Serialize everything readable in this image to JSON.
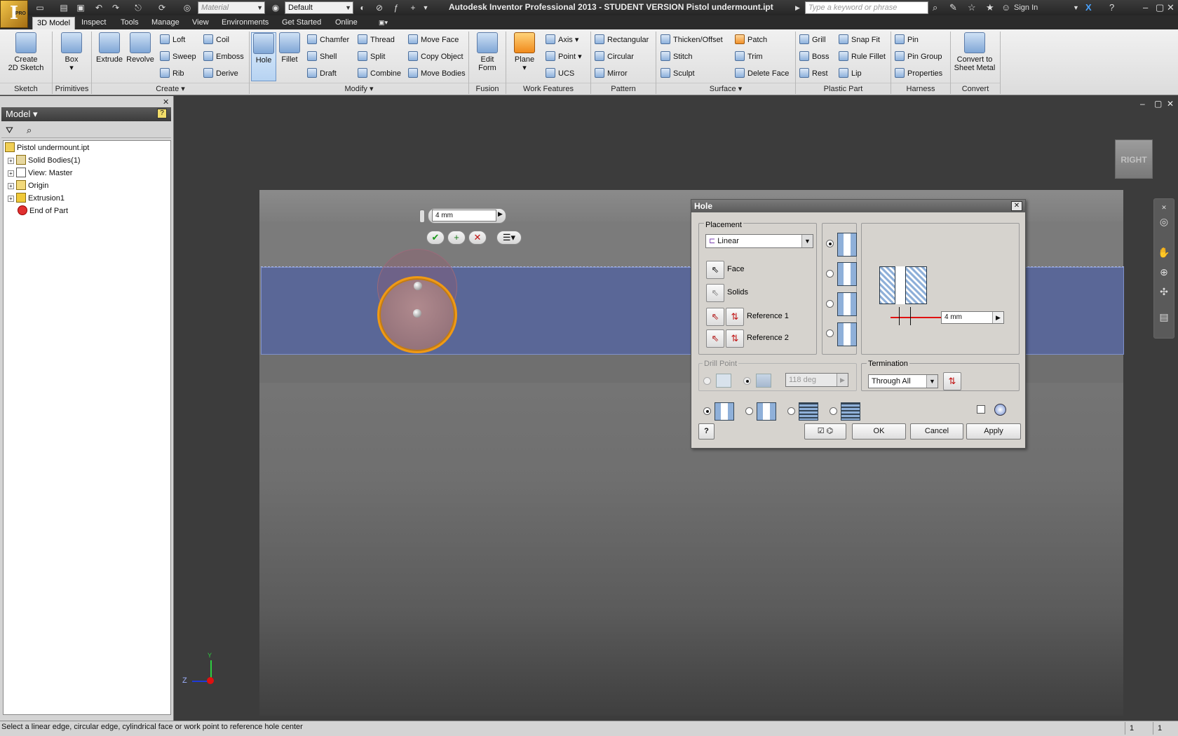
{
  "app": {
    "title": "Autodesk Inventor Professional 2013 - STUDENT VERSION   Pistol undermount.ipt",
    "logo_letter": "I",
    "logo_badge": "PRO",
    "material_placeholder": "Material",
    "appearance": "Default",
    "search_placeholder": "Type a keyword or phrase",
    "sign_in": "Sign In"
  },
  "menu_tabs": [
    "3D Model",
    "Inspect",
    "Tools",
    "Manage",
    "View",
    "Environments",
    "Get Started",
    "Online"
  ],
  "ribbon": {
    "sketch": {
      "label": "Sketch",
      "create_2d_sketch": "Create\n2D Sketch"
    },
    "primitives": {
      "label": "Primitives",
      "box": "Box"
    },
    "create": {
      "label": "Create",
      "extrude": "Extrude",
      "revolve": "Revolve",
      "col1": [
        "Loft",
        "Sweep",
        "Rib"
      ],
      "col2": [
        "Coil",
        "Emboss",
        "Derive"
      ]
    },
    "modify": {
      "label": "Modify",
      "hole": "Hole",
      "fillet": "Fillet",
      "col1": [
        "Chamfer",
        "Shell",
        "Draft"
      ],
      "col2": [
        "Thread",
        "Split",
        "Combine"
      ],
      "col3": [
        "Move Face",
        "Copy Object",
        "Move Bodies"
      ]
    },
    "fusion": {
      "label": "Fusion",
      "edit_form": "Edit\nForm"
    },
    "work_features": {
      "label": "Work Features",
      "plane": "Plane",
      "items": [
        "Axis",
        "Point",
        "UCS"
      ]
    },
    "pattern": {
      "label": "Pattern",
      "items": [
        "Rectangular",
        "Circular",
        "Mirror"
      ]
    },
    "surface": {
      "label": "Surface",
      "col1": [
        "Thicken/Offset",
        "Stitch",
        "Sculpt"
      ],
      "col2": [
        "Patch",
        "Trim",
        "Delete Face"
      ]
    },
    "plastic_part": {
      "label": "Plastic Part",
      "col1": [
        "Grill",
        "Boss",
        "Rest"
      ],
      "col2": [
        "Snap Fit",
        "Rule Fillet",
        "Lip"
      ]
    },
    "harness": {
      "label": "Harness",
      "items": [
        "Pin",
        "Pin Group",
        "Properties"
      ]
    },
    "convert": {
      "label": "Convert",
      "convert_to_sheet_metal": "Convert to\nSheet Metal"
    }
  },
  "browser": {
    "title": "Model",
    "tree": [
      {
        "label": "Pistol undermount.ipt",
        "expandable": false
      },
      {
        "label": "Solid Bodies(1)",
        "expandable": true
      },
      {
        "label": "View: Master",
        "expandable": true
      },
      {
        "label": "Origin",
        "expandable": true
      },
      {
        "label": "Extrusion1",
        "expandable": true
      },
      {
        "label": "End of Part",
        "expandable": false
      }
    ]
  },
  "viewport": {
    "viewcube_label": "RIGHT",
    "mini_toolbar_value": "4 mm",
    "triad": {
      "y": "Y",
      "z": "Z"
    }
  },
  "hole_dialog": {
    "title": "Hole",
    "placement_label": "Placement",
    "placement_value": "Linear",
    "face": "Face",
    "solids": "Solids",
    "reference1": "Reference 1",
    "reference2": "Reference 2",
    "diameter": "4 mm",
    "drill_point_label": "Drill Point",
    "drill_angle": "118 deg",
    "termination_label": "Termination",
    "termination_value": "Through All",
    "ok": "OK",
    "cancel": "Cancel",
    "apply": "Apply"
  },
  "status": {
    "prompt": "Select a linear edge, circular edge, cylindrical face or work point to reference hole center",
    "cell1": "1",
    "cell2": "1"
  },
  "colors": {
    "accent_blue": "#5a6797",
    "selection_orange": "#f09a14",
    "dark_chrome": "#2b2b2b"
  }
}
